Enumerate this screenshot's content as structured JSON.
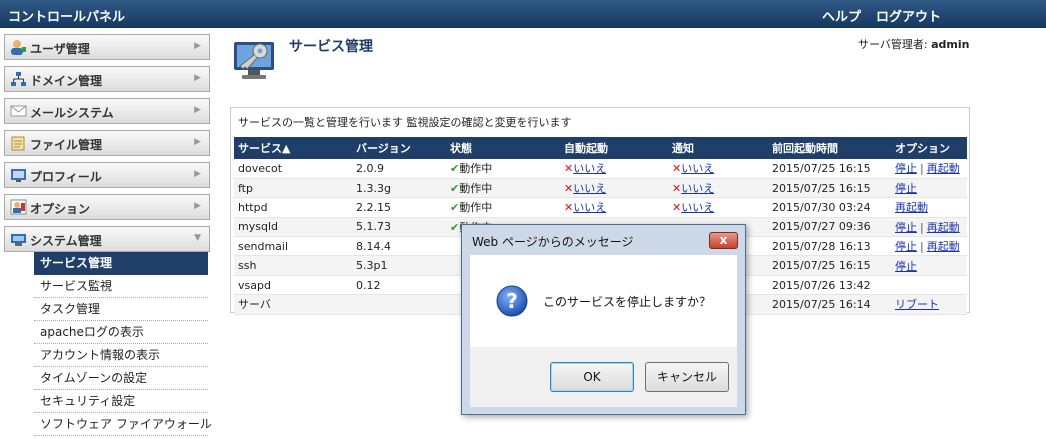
{
  "topbar": {
    "title": "コントロールパネル",
    "help": "ヘルプ",
    "logout": "ログアウト"
  },
  "sidebar": {
    "menus": [
      {
        "label": "ユーザ管理",
        "icon": "user-icon"
      },
      {
        "label": "ドメイン管理",
        "icon": "network-icon"
      },
      {
        "label": "メールシステム",
        "icon": "mail-icon"
      },
      {
        "label": "ファイル管理",
        "icon": "folder-icon"
      },
      {
        "label": "プロフィール",
        "icon": "profile-icon"
      },
      {
        "label": "オプション",
        "icon": "options-icon"
      },
      {
        "label": "システム管理",
        "icon": "system-icon"
      }
    ],
    "submenu": [
      "サービス管理",
      "サービス監視",
      "タスク管理",
      "apacheログの表示",
      "アカウント情報の表示",
      "タイムゾーンの設定",
      "セキュリティ設定",
      "ソフトウェア ファイアウォール"
    ]
  },
  "page": {
    "title": "サービス管理",
    "admin_prefix": "サーバ管理者: ",
    "admin_name": "admin",
    "description": "サービスの一覧と管理を行います 監視設定の確認と変更を行います"
  },
  "table": {
    "headers": [
      "サービス▲",
      "バージョン",
      "状態",
      "自動起動",
      "通知",
      "前回起動時間",
      "オプション"
    ],
    "rows": [
      {
        "name": "dovecot",
        "version": "2.0.9",
        "status": "動作中",
        "auto": "いいえ",
        "notify": "いいえ",
        "time": "2015/07/25 16:15",
        "opt1": "停止",
        "opt2": "再起動"
      },
      {
        "name": "ftp",
        "version": "1.3.3g",
        "status": "動作中",
        "auto": "いいえ",
        "notify": "いいえ",
        "time": "2015/07/25 16:15",
        "opt1": "停止",
        "opt2": ""
      },
      {
        "name": "httpd",
        "version": "2.2.15",
        "status": "動作中",
        "auto": "いいえ",
        "notify": "いいえ",
        "time": "2015/07/30 03:24",
        "opt1": "再起動",
        "opt2": ""
      },
      {
        "name": "mysqld",
        "version": "5.1.73",
        "status": "動作中",
        "auto": "",
        "notify": "",
        "time": "2015/07/27 09:36",
        "opt1": "停止",
        "opt2": "再起動"
      },
      {
        "name": "sendmail",
        "version": "8.14.4",
        "status": "",
        "auto": "",
        "notify": "",
        "time": "2015/07/28 16:13",
        "opt1": "停止",
        "opt2": "再起動"
      },
      {
        "name": "ssh",
        "version": "5.3p1",
        "status": "",
        "auto": "",
        "notify": "",
        "time": "2015/07/25 16:15",
        "opt1": "停止",
        "opt2": ""
      },
      {
        "name": "vsapd",
        "version": "0.12",
        "status": "",
        "auto": "",
        "notify": "",
        "time": "2015/07/26 13:42",
        "opt1": "",
        "opt2": ""
      },
      {
        "name": "サーバ",
        "version": "",
        "status": "",
        "auto": "",
        "notify": "",
        "time": "2015/07/25 16:14",
        "opt1": "リブート",
        "opt2": ""
      }
    ]
  },
  "dialog": {
    "title": "Web ページからのメッセージ",
    "close": "x",
    "message": "このサービスを停止しますか？",
    "ok": "OK",
    "cancel": "キャンセル"
  },
  "colors": {
    "header_bg": "#1f3f69",
    "topbar": "#16385f",
    "link": "#1a33b3",
    "ok_green": "#2c9a2c",
    "x_red": "#dd1111"
  }
}
